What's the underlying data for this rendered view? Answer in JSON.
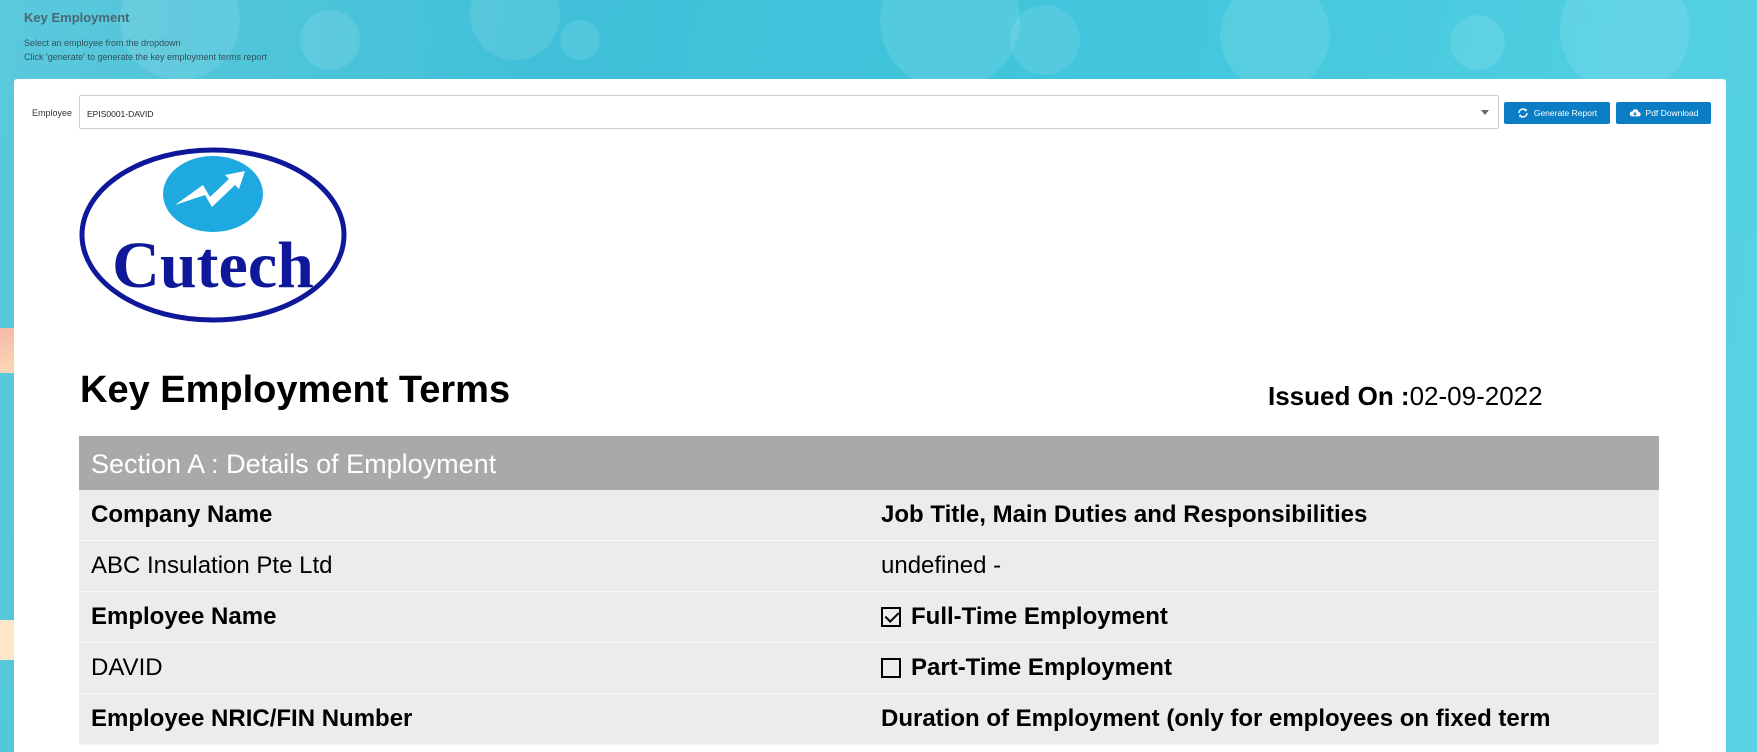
{
  "header": {
    "title": "Key Employment",
    "instruction_1": "Select an employee from the dropdown",
    "instruction_2": "Click 'generate' to generate the key employment terms report"
  },
  "form": {
    "employee_label": "Employee",
    "employee_value": "EPIS0001-DAVID",
    "generate_label": "Generate Report",
    "pdf_label": "Pdf Download"
  },
  "logo": {
    "text": "Cutech"
  },
  "report": {
    "title": "Key Employment Terms",
    "issued_label": "Issued On :",
    "issued_value": "02-09-2022",
    "section_a": {
      "heading": "Section A : Details of Employment",
      "company_name_label": "Company Name",
      "company_name_value": "ABC Insulation Pte Ltd",
      "employee_name_label": "Employee Name",
      "employee_name_value": "DAVID",
      "nric_label": "Employee NRIC/FIN Number",
      "job_title_label": "Job Title, Main Duties and Responsibilities",
      "job_title_value": "undefined -",
      "full_time_label": "Full-Time Employment",
      "full_time_checked": true,
      "part_time_label": "Part-Time Employment",
      "part_time_checked": false,
      "duration_label": "Duration of Employment (only for employees on fixed term"
    }
  },
  "colors": {
    "button": "#0b7dc4",
    "section_header": "#a9a9a9",
    "row_bg": "#ececec",
    "logo_blue": "#10189a",
    "logo_light": "#1fa9e1"
  },
  "icons": {
    "generate": "refresh-icon",
    "pdf": "cloud-download-icon",
    "dropdown": "caret-down-icon"
  }
}
